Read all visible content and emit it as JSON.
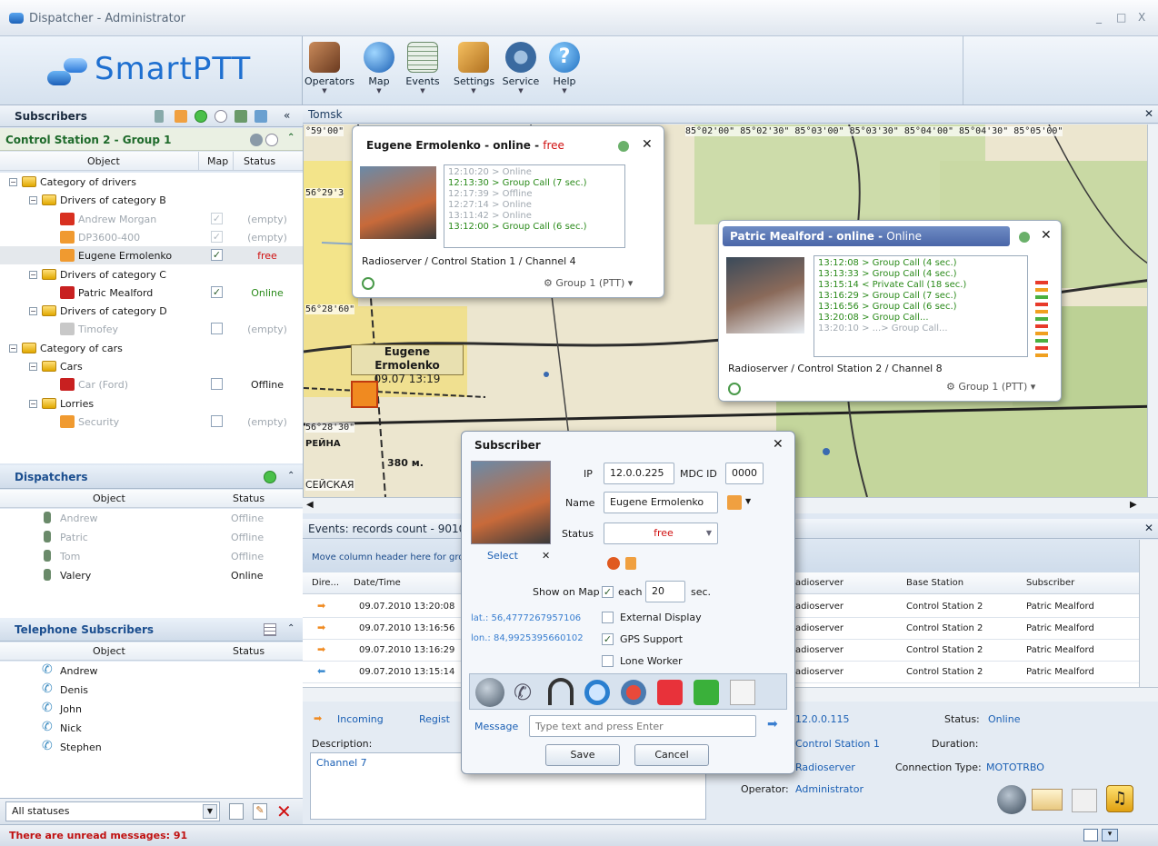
{
  "window": {
    "title": "Dispatcher - Administrator",
    "controls": [
      "_",
      "□",
      "X"
    ]
  },
  "logo": {
    "text": "SmartPTT"
  },
  "toolbar": {
    "items": [
      {
        "label": "Operators",
        "icon": "operators-icon",
        "color": "#8a5a3a"
      },
      {
        "label": "Map",
        "icon": "globe-icon",
        "color": "#2a7fd0"
      },
      {
        "label": "Events",
        "icon": "events-list-icon",
        "color": "#6a8a6a"
      },
      {
        "label": "Settings",
        "icon": "settings-tools-icon",
        "color": "#d08a2a"
      },
      {
        "label": "Service",
        "icon": "gears-icon",
        "color": "#3a6aa0"
      },
      {
        "label": "Help",
        "icon": "help-icon",
        "color": "#3a8ad0"
      }
    ]
  },
  "subscribers": {
    "title": "Subscribers",
    "collapse": "«",
    "group": "Control Station 2 - Group 1",
    "columns": {
      "object": "Object",
      "map": "Map",
      "status": "Status"
    },
    "tree": [
      {
        "label": "Category of drivers",
        "level": 0,
        "type": "folder",
        "sign": "−"
      },
      {
        "label": "Drivers of category B",
        "level": 1,
        "type": "folder",
        "sign": "−"
      },
      {
        "label": "Andrew Morgan",
        "level": 2,
        "type": "radio-red",
        "map": "✓",
        "map_gray": true,
        "status": "(empty)",
        "status_style": "gray",
        "name_style": "gray"
      },
      {
        "label": "DP3600-400",
        "level": 2,
        "type": "radio-orange",
        "map": "✓",
        "map_gray": true,
        "status": "(empty)",
        "status_style": "gray",
        "name_style": "gray"
      },
      {
        "label": "Eugene Ermolenko",
        "level": 2,
        "type": "radio-orange",
        "map": "✓",
        "status": "free",
        "status_style": "red",
        "selected": true
      },
      {
        "label": "Drivers of category C",
        "level": 1,
        "type": "folder",
        "sign": "−"
      },
      {
        "label": "Patric Mealford",
        "level": 2,
        "type": "car-red",
        "map": "✓",
        "status": "Online",
        "status_style": "green"
      },
      {
        "label": "Drivers of category D",
        "level": 1,
        "type": "folder",
        "sign": "−"
      },
      {
        "label": "Timofey",
        "level": 2,
        "type": "phone-gray",
        "map": "",
        "status": "(empty)",
        "status_style": "gray",
        "name_style": "gray"
      },
      {
        "label": "Category of cars",
        "level": 0,
        "type": "folder",
        "sign": "−"
      },
      {
        "label": "Cars",
        "level": 1,
        "type": "folder",
        "sign": "−"
      },
      {
        "label": "Car (Ford)",
        "level": 2,
        "type": "car-red",
        "map": "",
        "status": "Offline",
        "status_style": "dark",
        "name_style": "gray"
      },
      {
        "label": "Lorries",
        "level": 1,
        "type": "folder",
        "sign": "−"
      },
      {
        "label": "Security",
        "level": 2,
        "type": "radio-orange",
        "map": "",
        "status": "(empty)",
        "status_style": "gray",
        "name_style": "gray"
      }
    ]
  },
  "dispatchers": {
    "title": "Dispatchers",
    "columns": {
      "object": "Object",
      "status": "Status"
    },
    "items": [
      {
        "name": "Andrew",
        "status": "Offline"
      },
      {
        "name": "Patric",
        "status": "Offline"
      },
      {
        "name": "Tom",
        "status": "Offline"
      },
      {
        "name": "Valery",
        "status": "Online"
      }
    ]
  },
  "telephone": {
    "title": "Telephone Subscribers",
    "columns": {
      "object": "Object",
      "status": "Status"
    },
    "items": [
      "Andrew",
      "Denis",
      "John",
      "Nick",
      "Stephen"
    ]
  },
  "filter": {
    "value": "All statuses"
  },
  "statusbar": {
    "message": "There are unread messages: 91"
  },
  "map": {
    "tab": "Tomsk",
    "coords_top": "85°02'00\"  85°02'30\"  85°03'00\"  85°03'30\"  85°04'00\"  85°04'30\"  85°05'00\"",
    "coord_top_left": "°59'00\"",
    "coord_1": "56°29'3",
    "coord_2": "56°28'60\"",
    "coord_3": "56°28'30\"",
    "label_name": "Eugene Ermolenko",
    "label_time": "09.07 13:19",
    "road_label": "380 м.",
    "city_label": "СЕЙСКАЯ",
    "street_label": "РЕЙНА"
  },
  "popup_eugene": {
    "name": "Eugene Ermolenko",
    "sep": " - ",
    "state": "online",
    "status": "free",
    "log": [
      {
        "time": "12:10:20",
        "text": "> Online",
        "style": "gray"
      },
      {
        "time": "12:13:30",
        "text": "> Group Call (7 sec.)",
        "style": "green"
      },
      {
        "time": "12:17:39",
        "text": "> Offline",
        "style": "gray"
      },
      {
        "time": "12:27:14",
        "text": "> Online",
        "style": "gray"
      },
      {
        "time": "13:11:42",
        "text": "> Online",
        "style": "gray"
      },
      {
        "time": "13:12:00",
        "text": "> Group Call (6 sec.)",
        "style": "green"
      }
    ],
    "route": "Radioserver / Control Station 1 / Channel 4",
    "group": "Group 1 (PTT)"
  },
  "popup_patric": {
    "name": "Patric Mealford",
    "sep": " - ",
    "state": "online",
    "status": "Online",
    "log": [
      {
        "time": "13:12:08",
        "text": "> Group Call (4 sec.)",
        "style": "green"
      },
      {
        "time": "13:13:33",
        "text": "> Group Call (4 sec.)",
        "style": "green"
      },
      {
        "time": "13:15:14",
        "text": "< Private Call (18 sec.)",
        "style": "green"
      },
      {
        "time": "13:16:29",
        "text": "> Group Call (7 sec.)",
        "style": "green"
      },
      {
        "time": "13:16:56",
        "text": "> Group Call (6 sec.)",
        "style": "green"
      },
      {
        "time": "13:20:08",
        "text": "> Group Call...",
        "style": "green"
      },
      {
        "time": "13:20:10",
        "text": "> ...> Group Call...",
        "style": "gray"
      }
    ],
    "route": "Radioserver / Control Station 2 / Channel 8",
    "group": "Group 1 (PTT)"
  },
  "events": {
    "title": "Events: records count - 9010",
    "group_hint": "Move column header here for gro",
    "columns": {
      "dir": "Dire...",
      "datetime": "Date/Time",
      "radioserver": "adioserver",
      "base": "Base Station",
      "subscriber": "Subscriber"
    },
    "rows": [
      {
        "dir": "out",
        "datetime": "09.07.2010 13:20:08",
        "radioserver": "adioserver",
        "base": "Control Station 2",
        "subscriber": "Patric Mealford"
      },
      {
        "dir": "out",
        "datetime": "09.07.2010 13:16:56",
        "radioserver": "adioserver",
        "base": "Control Station 2",
        "subscriber": "Patric Mealford"
      },
      {
        "dir": "out",
        "datetime": "09.07.2010 13:16:29",
        "radioserver": "adioserver",
        "base": "Control Station 2",
        "subscriber": "Patric Mealford"
      },
      {
        "dir": "in",
        "datetime": "09.07.2010 13:15:14",
        "radioserver": "adioserver",
        "base": "Control Station 2",
        "subscriber": "Patric Mealford"
      }
    ]
  },
  "details": {
    "incoming": "Incoming",
    "regist": "Regist",
    "description_label": "Description:",
    "description_value": "Channel 7",
    "ip": "12.0.0.115",
    "station": "Control Station 1",
    "radioserver": "Radioserver",
    "status_label": "Status:",
    "status_value": "Online",
    "duration_label": "Duration:",
    "conn_label": "Connection Type:",
    "conn_value": "MOTOTRBO",
    "operator_label": "Operator:",
    "operator_value": "Administrator"
  },
  "dialog": {
    "title": "Subscriber",
    "select": "Select",
    "ip_label": "IP",
    "ip_value": "12.0.0.225",
    "mdc_label": "MDC ID",
    "mdc_value": "0000",
    "name_label": "Name",
    "name_value": "Eugene Ermolenko",
    "status_label": "Status",
    "status_value": "free",
    "show_on_map": "Show on Map",
    "each": "each",
    "each_value": "20",
    "sec": "sec.",
    "lat": "lat.: 56,4777267957106",
    "lon": "lon.: 84,9925395660102",
    "external_display": "External Display",
    "gps_support": "GPS Support",
    "lone_worker": "Lone Worker",
    "message_label": "Message",
    "message_placeholder": "Type text and press Enter",
    "save": "Save",
    "cancel": "Cancel"
  }
}
